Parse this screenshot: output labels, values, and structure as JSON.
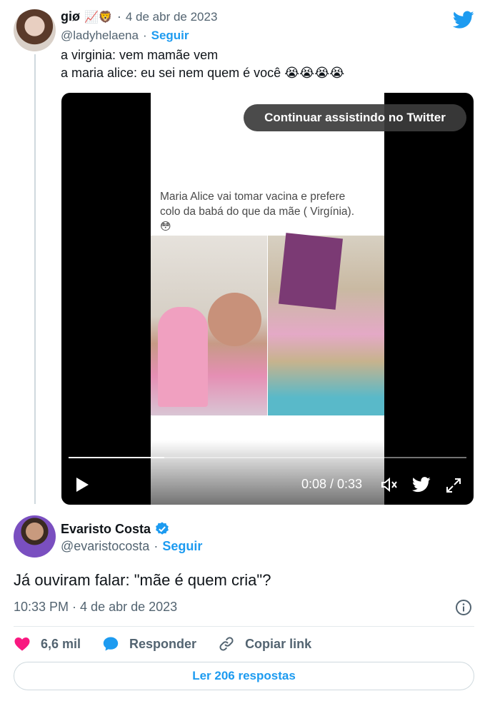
{
  "quoted_tweet": {
    "name": "giø",
    "name_emojis": "📈🦁",
    "separator": "·",
    "date": "4 de abr de 2023",
    "handle": "@ladyhelaena",
    "dot": "·",
    "follow_label": "Seguir",
    "text_line1": "a virginia: vem mamãe vem",
    "text_line2": "a maria alice: eu sei nem quem é você 😭😭😭😭",
    "avatar_icon": "avatar-photo"
  },
  "video": {
    "continue_label": "Continuar assistindo no Twitter",
    "caption_line1": "Maria Alice vai tomar  vacina e prefere",
    "caption_line2": "colo da babá do que da mãe ( Virgínia).",
    "caption_emoji": "😳",
    "time": "0:08 / 0:33",
    "progress": 0.24,
    "icons": [
      "play-icon",
      "volume-icon",
      "twitter-icon",
      "fullscreen-icon"
    ]
  },
  "main_tweet": {
    "name": "Evaristo Costa",
    "verified": true,
    "handle": "@evaristocosta",
    "dot": "·",
    "follow_label": "Seguir",
    "text": "Já ouviram falar: \"mãe é quem cria\"?",
    "meta": "10:33 PM · 4 de abr de 2023"
  },
  "actions": {
    "likes": "6,6 mil",
    "reply_label": "Responder",
    "copy_label": "Copiar link"
  },
  "read_replies_label": "Ler 206 respostas",
  "colors": {
    "accent": "#1d9bf0",
    "like": "#f91880",
    "secondary_text": "#536471"
  }
}
